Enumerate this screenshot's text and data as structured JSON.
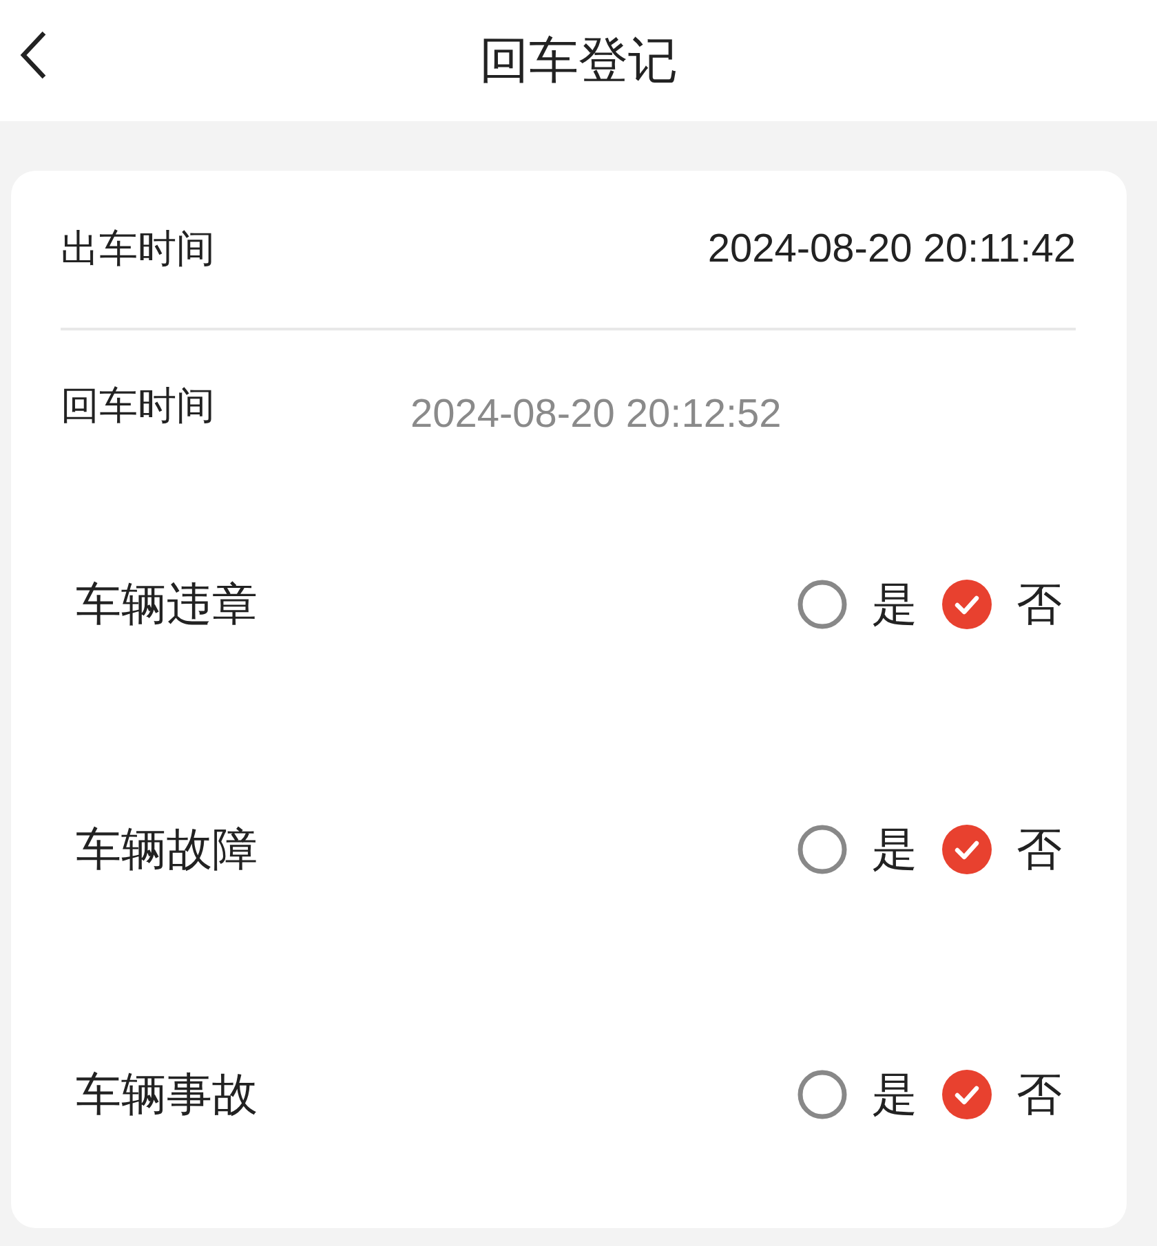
{
  "header": {
    "title": "回车登记"
  },
  "times": [
    {
      "label": "出车时间",
      "value": "2024-08-20 20:11:42",
      "kind": "fixed"
    },
    {
      "label": "回车时间",
      "value": "2024-08-20 20:12:52",
      "kind": "picker"
    }
  ],
  "questions": [
    {
      "label": "车辆违章",
      "options": [
        {
          "label": "是",
          "selected": false
        },
        {
          "label": "否",
          "selected": true
        }
      ]
    },
    {
      "label": "车辆故障",
      "options": [
        {
          "label": "是",
          "selected": false
        },
        {
          "label": "否",
          "selected": true
        }
      ]
    },
    {
      "label": "车辆事故",
      "options": [
        {
          "label": "是",
          "selected": false
        },
        {
          "label": "否",
          "selected": true
        }
      ]
    }
  ]
}
